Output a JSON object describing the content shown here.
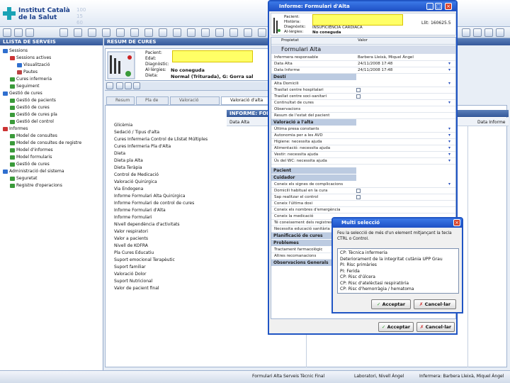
{
  "header": {
    "logo_line1": "Institut Català",
    "logo_line2": "de la Salut",
    "faded_numbers": [
      "100",
      "15",
      "60"
    ]
  },
  "left_panel": {
    "title": "LLISTA DE SERVEIS",
    "items": [
      {
        "label": "Sessions",
        "color": "#2f6fcf",
        "indent": 0
      },
      {
        "label": "Sessions actives",
        "color": "#c33",
        "indent": 1
      },
      {
        "label": "Visualització",
        "color": "#2f6fcf",
        "indent": 2
      },
      {
        "label": "Pautes",
        "color": "#b44",
        "indent": 2
      },
      {
        "label": "Cures infermeria",
        "color": "#3a9a3a",
        "indent": 1
      },
      {
        "label": "Seguiment",
        "color": "#3a9a3a",
        "indent": 1
      },
      {
        "label": "Gestió de cures",
        "color": "#2f6fcf",
        "indent": 0
      },
      {
        "label": "Gestió de pacients",
        "color": "#3a9a3a",
        "indent": 1
      },
      {
        "label": "Gestió de cures",
        "color": "#3a9a3a",
        "indent": 1
      },
      {
        "label": "Gestió de cures pla",
        "color": "#3a9a3a",
        "indent": 1
      },
      {
        "label": "Gestió del control",
        "color": "#3a9a3a",
        "indent": 1
      },
      {
        "label": "Informes",
        "color": "#c33",
        "indent": 0
      },
      {
        "label": "Model de consultes",
        "color": "#3a9a3a",
        "indent": 1
      },
      {
        "label": "Model de consultes de registre",
        "color": "#3a9a3a",
        "indent": 1
      },
      {
        "label": "Model d'informes",
        "color": "#3a9a3a",
        "indent": 1
      },
      {
        "label": "Model formularis",
        "color": "#3a9a3a",
        "indent": 1
      },
      {
        "label": "Gestió de cures",
        "color": "#3a9a3a",
        "indent": 1
      },
      {
        "label": "Administració del sistema",
        "color": "#2f6fcf",
        "indent": 0
      },
      {
        "label": "Seguretat",
        "color": "#3a9a3a",
        "indent": 1
      },
      {
        "label": "Registre d'operacions",
        "color": "#3a9a3a",
        "indent": 1
      }
    ]
  },
  "main": {
    "section_title": "RESUM DE CURES",
    "patient": {
      "labels": [
        "Pacient:",
        "Edat:",
        "Diagnòstic:",
        "Al·lèrgies:",
        "Dieta:"
      ],
      "allergies_value": "No coneguda",
      "diet_value": "Normal (Triturada), G: Gorra sal"
    },
    "tabs": [
      "Resum",
      "Pla de cures",
      "Valoració",
      "Valoració d'alta"
    ],
    "report_title": "INFORME: FORMULARI D'ALTA",
    "grid_headers": [
      "Data Alta",
      "Data Informe"
    ],
    "list_items": [
      "Glicèmia",
      "Sedació / Tipus d'alta",
      "Cures Infermeria Control de Llistat Múltiples",
      "Cures Infermeria Pla d'Alta",
      "Dieta",
      "Dieta pla Alta",
      "Dieta Teràpia",
      "Control de Medicació",
      "Valoració Quirúrgica",
      "Via Endogena",
      "Informe Formulari Alta Quirúrgica",
      "Informe Formulari de control de cures",
      "Informe Formulari d'Alta",
      "Informe Formulari",
      "Nivell dependència d'activitats",
      "Valor respiratori",
      "Valor a pacients",
      "Nivell de KOFRA",
      "Pla Cures Educatiu",
      "Suport emocional Terapèutic",
      "Suport familiar",
      "Valoració Dolor",
      "Suport Nutricional",
      "Valor de pacient final"
    ]
  },
  "status_bar": {
    "cells": [
      "Formulari Alta Serveis Tècnic Final",
      "Laboratori, Nivell Àngel",
      "Infermera: Barbera Lleixà, Miquel Àngel"
    ]
  },
  "form_window": {
    "title": "Informe: Formulari d'Alta",
    "ids": "Llit: 160625.5",
    "patient_labels": [
      "Pacient:",
      "Història:",
      "Diagnòstic:",
      "Al·lèrgies:"
    ],
    "diagnosis": "INSUFICIÈNCIA CARDIACA",
    "allergies": "No coneguda",
    "col_property": "Propietat",
    "col_value": "Valor",
    "form_title": "Formulari Alta",
    "rows": [
      {
        "label": "Infermera responsable",
        "value": "Barbera Lleixà, Miquel Àngel"
      },
      {
        "label": "Data Alta",
        "value": "24/11/2008 17:48"
      },
      {
        "label": "Data Informe",
        "value": "24/11/2008 17:48"
      }
    ],
    "sections": [
      "Destí",
      "Valoració a l'alta",
      "Pacient",
      "Cuidador",
      "Planificació de cures",
      "Problemes",
      "Observacions Generals"
    ],
    "desti_rows": [
      "Alta Domicili",
      "Trasllat centre hospitalari",
      "Trasllat centre soci-sanitari",
      "Continuïtat de cures",
      "Observacions",
      "Resum de l'estat del pacient"
    ],
    "valoracio_rows": [
      "Última presa constants",
      "Autonomia per a les AVD",
      "Higiene: necessita ajuda",
      "Alimentació: necessita ajuda",
      "Vestir: necessita ajuda",
      "Ús del WC: necessita ajuda"
    ],
    "cuidador_rows": [
      "Coneix els signes de complicacions",
      "Domicili habitual en la cura",
      "Sap realitzar el control",
      "Coneix l'última dosi",
      "Coneix els nombres d'emergència",
      "Coneix la medicació",
      "Té coneixement dels registres",
      "Necessita educació sanitària"
    ],
    "problems_row": "Tractament farmacològic",
    "extra_row": "Altres recomanacions",
    "accept": "Acceptar",
    "cancel": "Cancel·lar"
  },
  "multi_dialog": {
    "title": "Multi selecció",
    "instruction": "Feu la selecció de més d'un element mitjançant la tecla CTRL o Control.",
    "options": [
      "CP: Tècnica infermeria",
      "Deteriorament de la integritat cutània UPP Grau",
      "PI: Risc primàries",
      "PI: Ferida",
      "CP: Risc d'úlcera",
      "CP: Risc d'atelèctasi respiratòria",
      "CP: Risc d'hemorràgia / hematoma"
    ],
    "accept": "Acceptar",
    "cancel": "Cancel·lar"
  }
}
